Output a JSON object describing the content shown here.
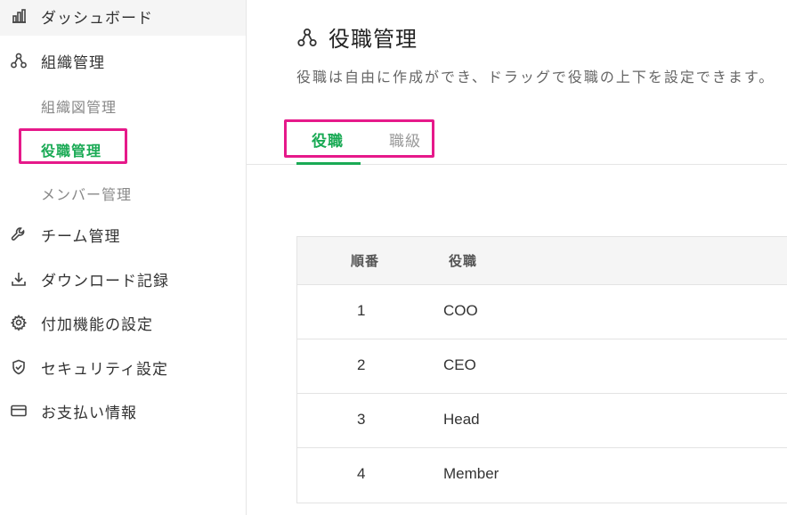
{
  "sidebar": {
    "items": [
      {
        "label": "ダッシュボード",
        "icon": "bar-chart-icon"
      },
      {
        "label": "組織管理",
        "icon": "org-chart-icon"
      },
      {
        "label": "チーム管理",
        "icon": "wrench-icon"
      },
      {
        "label": "ダウンロード記録",
        "icon": "download-icon"
      },
      {
        "label": "付加機能の設定",
        "icon": "gear-icon"
      },
      {
        "label": "セキュリティ設定",
        "icon": "shield-check-icon"
      },
      {
        "label": "お支払い情報",
        "icon": "credit-card-icon"
      }
    ],
    "sub_items": [
      {
        "label": "組織図管理"
      },
      {
        "label": "役職管理"
      },
      {
        "label": "メンバー管理"
      }
    ]
  },
  "main": {
    "title": "役職管理",
    "title_icon": "org-chart-icon",
    "description": "役職は自由に作成ができ、ドラッグで役職の上下を設定できます。",
    "tabs": [
      {
        "label": "役職"
      },
      {
        "label": "職級"
      }
    ],
    "table": {
      "headers": [
        "順番",
        "役職"
      ],
      "rows": [
        {
          "order": "1",
          "position": "COO"
        },
        {
          "order": "2",
          "position": "CEO"
        },
        {
          "order": "3",
          "position": "Head"
        },
        {
          "order": "4",
          "position": "Member"
        }
      ]
    }
  },
  "colors": {
    "accent": "#1aaa55",
    "highlight": "#e6198a"
  }
}
